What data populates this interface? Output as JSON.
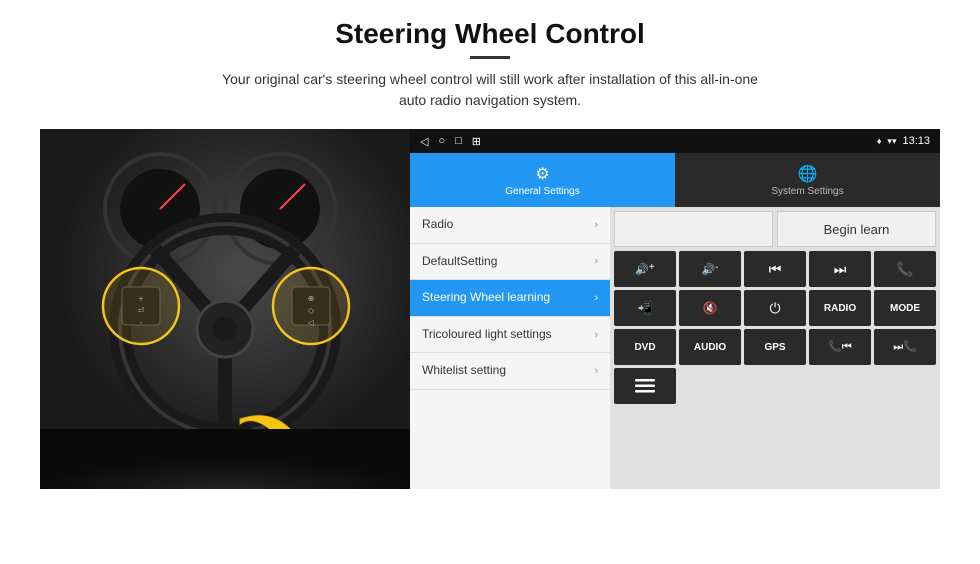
{
  "page": {
    "title": "Steering Wheel Control",
    "divider": true,
    "subtitle": "Your original car's steering wheel control will still work after installation of this all-in-one\nauto radio navigation system."
  },
  "android_ui": {
    "status_bar": {
      "back_icon": "◁",
      "circle_icon": "○",
      "square_icon": "□",
      "menu_icon": "⊞",
      "location_icon": "♦",
      "wifi_icon": "▾",
      "signal_icon": "▾",
      "time": "13:13"
    },
    "tabs": [
      {
        "id": "general",
        "label": "General Settings",
        "icon": "⚙",
        "active": true
      },
      {
        "id": "system",
        "label": "System Settings",
        "icon": "🌐",
        "active": false
      }
    ],
    "menu_items": [
      {
        "id": "radio",
        "label": "Radio",
        "active": false
      },
      {
        "id": "default",
        "label": "DefaultSetting",
        "active": false
      },
      {
        "id": "steering",
        "label": "Steering Wheel learning",
        "active": true
      },
      {
        "id": "tricoloured",
        "label": "Tricoloured light settings",
        "active": false
      },
      {
        "id": "whitelist",
        "label": "Whitelist setting",
        "active": false
      }
    ],
    "controls": {
      "begin_learn": "Begin learn",
      "row1": [
        {
          "symbol": "🔊+",
          "label": "vol+"
        },
        {
          "symbol": "🔊-",
          "label": "vol-"
        },
        {
          "symbol": "⏮",
          "label": "prev"
        },
        {
          "symbol": "⏭",
          "label": "next"
        },
        {
          "symbol": "📞",
          "label": "call"
        }
      ],
      "row2": [
        {
          "symbol": "📞↙",
          "label": "answer"
        },
        {
          "symbol": "🔇",
          "label": "mute"
        },
        {
          "symbol": "⏻",
          "label": "power"
        },
        {
          "symbol": "RADIO",
          "label": "RADIO"
        },
        {
          "symbol": "MODE",
          "label": "MODE"
        }
      ],
      "row3": [
        {
          "symbol": "DVD",
          "label": "DVD"
        },
        {
          "symbol": "AUDIO",
          "label": "AUDIO"
        },
        {
          "symbol": "GPS",
          "label": "GPS"
        },
        {
          "symbol": "📞⏮",
          "label": "tel-prev"
        },
        {
          "symbol": "⏮📞",
          "label": "prev-tel"
        }
      ],
      "row4": [
        {
          "symbol": "🎵",
          "label": "menu"
        }
      ]
    }
  }
}
